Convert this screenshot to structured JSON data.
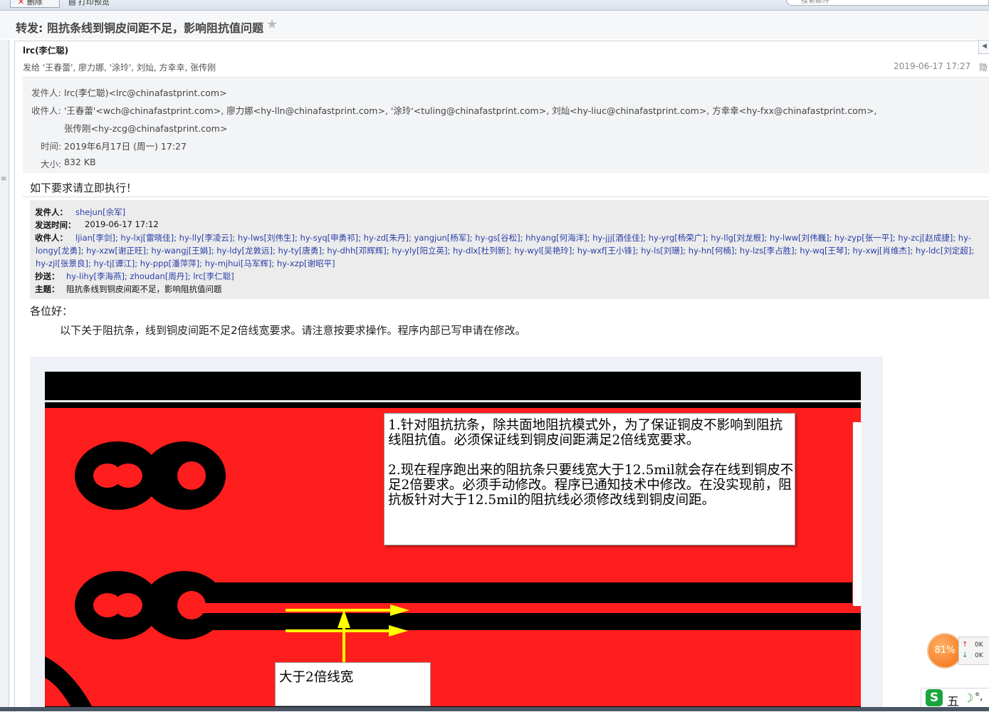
{
  "toolbar": {
    "delete_label": "删除",
    "print_label": "打印预览",
    "search_placeholder": "搜索邮件"
  },
  "email": {
    "subject": "转发: 阻抗条线到铜皮间距不足，影响阻抗值问题",
    "sender_display": "lrc(李仁聪)",
    "sent_to_summary": "发给 '王春蕾', 廖力娜, '涂玲', 刘灿, 方幸幸, 张传刚",
    "date": "2019-06-17 17:27",
    "hide_label": "隐",
    "details": {
      "from_label": "发件人:",
      "from_value": "lrc(李仁聪)<lrc@chinafastprint.com>",
      "to_label": "收件人:",
      "to_value_line1": "'王春蕾'<wch@chinafastprint.com>,  廖力娜<hy-lln@chinafastprint.com>,  '涂玲'<tuling@chinafastprint.com>,  刘灿<hy-liuc@chinafastprint.com>,  方幸幸<hy-fxx@chinafastprint.com>,",
      "to_value_line2": "张传刚<hy-zcg@chinafastprint.com>",
      "time_label": "时间:",
      "time_value": "2019年6月17日 (周一) 17:27",
      "size_label": "大小:",
      "size_value": "832 KB"
    },
    "instruction": "如下要求请立即执行！",
    "forwarded": {
      "from_label": "发件人：",
      "from_value": "shejun[佘军]",
      "time_label": "发送时间：",
      "time_value": "2019-06-17 17:12",
      "to_label": "收件人：",
      "to_line1": "ljian[李剑]; hy-lxj[雷晓佳]; hy-lly[李凌云]; hy-lws[刘伟生]; hy-syq[申勇祁]; hy-zd[朱丹]; yangjun[杨军]; hy-gs[谷松]; hhyang[何海洋]; hy-jjj[酒佳佳]; hy-yrg[杨荣广]; hy-llg[刘龙根]; hy-lww[刘伟巍]; hy-zyp[张一平]; hy-zcj[赵成捷]; hy-",
      "to_line2": "longy[龙勇]; hy-xzw[谢正旺]; hy-wangj[王娟]; hy-ldy[龙敦远]; hy-ty[唐勇]; hy-dhh[邓辉辉]; hy-yly[阳立英]; hy-dlx[杜列新]; hy-wyl[吴艳玲]; hy-wxf[王小锋]; hy-ls[刘珊]; hy-hn[何楠]; hy-lzs[李占胜]; hy-wq[王琴]; hy-xwj[肖维杰]; hy-ldc[刘定超];",
      "to_line3": "hy-zjl[张景良]; hy-tj[谭江]; hy-ppp[潘萍萍]; hy-mjhui[马军辉]; hy-xzp[谢昭平]",
      "cc_label": "抄送：",
      "cc_value": "hy-lihy[李海燕]; zhoudan[周丹]; lrc[李仁聪]",
      "subject_label": "主题：",
      "subject_value": "阻抗条线到铜皮间距不足，影响阻抗值问题"
    },
    "greeting": "各位好：",
    "body": "以下关于阻抗条，线到铜皮间距不足2倍线宽要求。请注意按要求操作。程序内部已写申请在修改。",
    "image": {
      "note_p1": "1.针对阻抗抗条，除共面地阻抗模式外，为了保证铜皮不影响到阻抗线阻抗值。必须保证线到铜皮间距满足2倍线宽要求。",
      "note_p2": "2.现在程序跑出来的阻抗条只要线宽大于12.5mil就会存在线到铜皮不足2倍要求。必须手动修改。程序已通知技术中修改。在没实现前，阻抗板针对大于12.5mil的阻抗线必须修改线到铜皮间距。",
      "arrow_label": "大于2倍线宽"
    }
  },
  "widgets": {
    "cpu_percent": "81%",
    "net_up": "0K",
    "net_down": "0K",
    "ime_logo": "S",
    "ime_mode": "五",
    "ime_moon": "☽",
    "ime_punct": "°,"
  },
  "colors": {
    "pcb_red": "#ff1e1e",
    "pcb_black": "#000000",
    "arrow_yellow": "#ffff00",
    "link_blue": "#2b3fa8"
  }
}
